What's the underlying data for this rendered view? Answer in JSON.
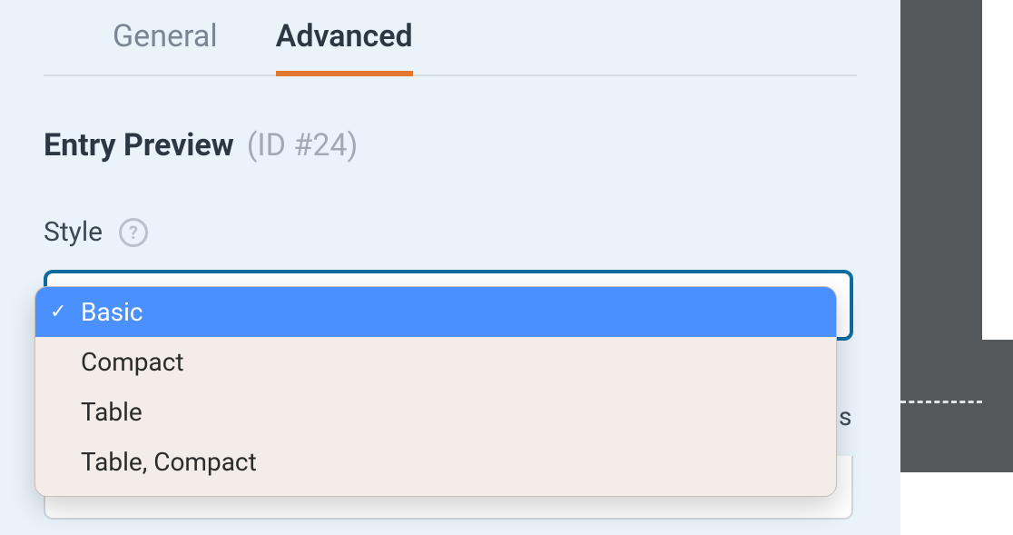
{
  "tabs": [
    {
      "label": "General",
      "active": false
    },
    {
      "label": "Advanced",
      "active": true
    }
  ],
  "section": {
    "title": "Entry Preview",
    "id_label": "(ID #24)"
  },
  "field": {
    "label": "Style",
    "help": "?"
  },
  "dropdown": {
    "selected_index": 0,
    "options": [
      "Basic",
      "Compact",
      "Table",
      "Table, Compact"
    ]
  },
  "peek_char": "s"
}
